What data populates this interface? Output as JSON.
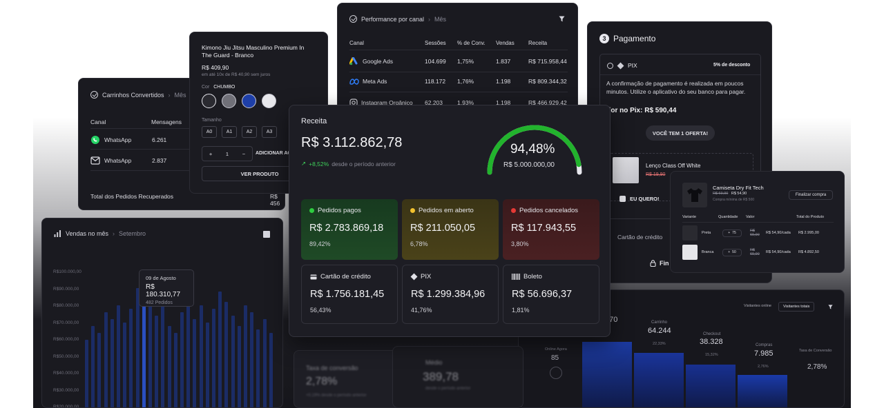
{
  "carrinhos": {
    "title": "Carrinhos Convertidos",
    "period": "Mês",
    "col_canal": "Canal",
    "col_mensagens": "Mensagens",
    "rows": [
      {
        "canal": "WhatsApp",
        "mensagens": "6.261"
      },
      {
        "canal": "WhatsApp",
        "mensagens": "2.837"
      }
    ],
    "total_label": "Total dos Pedidos Recuperados",
    "total_value": "R$ 456"
  },
  "kimono": {
    "title": "Kimono Jiu Jitsu Masculino Premium In The Guard - Branco",
    "price": "R$ 409,90",
    "installments": "em até 10x de R$ 40,90 sem juros",
    "color_label": "Cor",
    "color_value": "CHUMBO",
    "size_label": "Tamanho",
    "sizes": [
      "A0",
      "A1",
      "A2",
      "A3"
    ],
    "qty": "1",
    "plus": "+",
    "minus": "−",
    "add_label": "ADICIONAR AO",
    "view_label": "VER PRODUTO"
  },
  "performance": {
    "title": "Performance por canal",
    "period": "Mês",
    "columns": [
      "Canal",
      "Sessões",
      "% de Conv.",
      "Vendas",
      "Receita"
    ],
    "rows": [
      {
        "canal": "Google Ads",
        "sessoes": "104.699",
        "conv": "1,75%",
        "vendas": "1.837",
        "receita": "R$ 715.958,44"
      },
      {
        "canal": "Meta Ads",
        "sessoes": "118.172",
        "conv": "1,76%",
        "vendas": "1.198",
        "receita": "R$ 809.344,32"
      },
      {
        "canal": "Instagram Orgânico",
        "sessoes": "62.203",
        "conv": "1,93%",
        "vendas": "1.198",
        "receita": "R$ 466.929,42"
      }
    ]
  },
  "pagamento": {
    "step": "3",
    "title": "Pagamento",
    "pix_label": "PIX",
    "discount": "5% de desconto",
    "pix_text": "A confirmação de pagamento é realizada em poucos minutos. Utilize o aplicativo do seu banco para pagar.",
    "pix_value": "alor no Pix: R$ 590,44",
    "offer_button": "VOCÊ TEM 1 OFERTA!",
    "offer_product": "Lenço Class Off White",
    "offer_price": "R$ 19,90",
    "accept_label": "EU QUERO!",
    "card_label": "Cartão de crédito",
    "finish_label": "Fin"
  },
  "camiseta": {
    "title": "Camiseta Dry Fit Tech",
    "old_price": "R$ 69,90",
    "price": "R$ 54,90",
    "min_note": "Compra mínima de R$ 500",
    "button": "Finalizar compra",
    "columns": [
      "Variante",
      "Quantidade",
      "Valor",
      "Total do Produto"
    ],
    "rows": [
      {
        "variant": "Preta",
        "qty": "75",
        "old": "R$ 69,90",
        "unit": "R$ 54,90/cada",
        "total": "R$ 2.995,00"
      },
      {
        "variant": "Branca",
        "qty": "50",
        "old": "R$ 69,90",
        "unit": "R$ 54,90/cada",
        "total": "R$ 4.892,50"
      }
    ]
  },
  "vendas": {
    "title": "Vendas no mês",
    "period": "Setembro",
    "y_ticks": [
      "R$100.000,00",
      "R$90.000,00",
      "R$80.000,00",
      "R$70.000,00",
      "R$60.000,00",
      "R$50.000,00",
      "R$40.000,00",
      "R$30.000,00",
      "R$20.000,00"
    ],
    "tooltip_date": "09 de Agosto",
    "tooltip_value": "R$ 180.310,77",
    "tooltip_orders": "482 Pedidos"
  },
  "receita": {
    "title": "Receita",
    "value": "R$ 3.112.862,78",
    "growth": "+8,52%",
    "growth_note": "desde o período anterior",
    "gauge_pct": "94,48%",
    "gauge_target": "R$ 5.000.000,00",
    "gauge_fraction": 0.9448,
    "status": [
      {
        "label": "Pedidos pagos",
        "value": "R$ 2.783.869,18",
        "pct": "89,42%",
        "color": "#2ecc40"
      },
      {
        "label": "Pedidos em aberto",
        "value": "R$ 211.050,05",
        "pct": "6,78%",
        "color": "#f2c12e"
      },
      {
        "label": "Pedidos cancelados",
        "value": "R$ 117.943,55",
        "pct": "3,80%",
        "color": "#e53935"
      }
    ],
    "methods": [
      {
        "label": "Cartão de crédito",
        "value": "R$ 1.756.181,45",
        "pct": "56,43%",
        "icon": "credit-card-icon"
      },
      {
        "label": "PIX",
        "value": "R$ 1.299.384,96",
        "pct": "41,76%",
        "icon": "pix-icon"
      },
      {
        "label": "Boleto",
        "value": "R$ 56.696,37",
        "pct": "1,81%",
        "icon": "barcode-icon"
      }
    ]
  },
  "funnel": {
    "tab_online": "Visitantes online",
    "tab_total": "Visitantes totais",
    "partial_value": "770",
    "online_label": "Online Agora",
    "online_value": "85",
    "stages": [
      {
        "label": "Carrinho",
        "value": "64.244",
        "pct": "22,33%"
      },
      {
        "label": "Checkout",
        "value": "38.328",
        "pct": "15,32%"
      },
      {
        "label": "Compras",
        "value": "7.985",
        "pct": "2,76%"
      }
    ],
    "conv_label": "Taxa de Conversão",
    "conv_value": "2,78%"
  },
  "taxa": {
    "title": "Taxa de conversão",
    "value": "2,78%",
    "note": "+0,19% desde o período anterior"
  },
  "ticket": {
    "title": "Médio",
    "value": "389,78",
    "note": "desde o período anterior"
  }
}
